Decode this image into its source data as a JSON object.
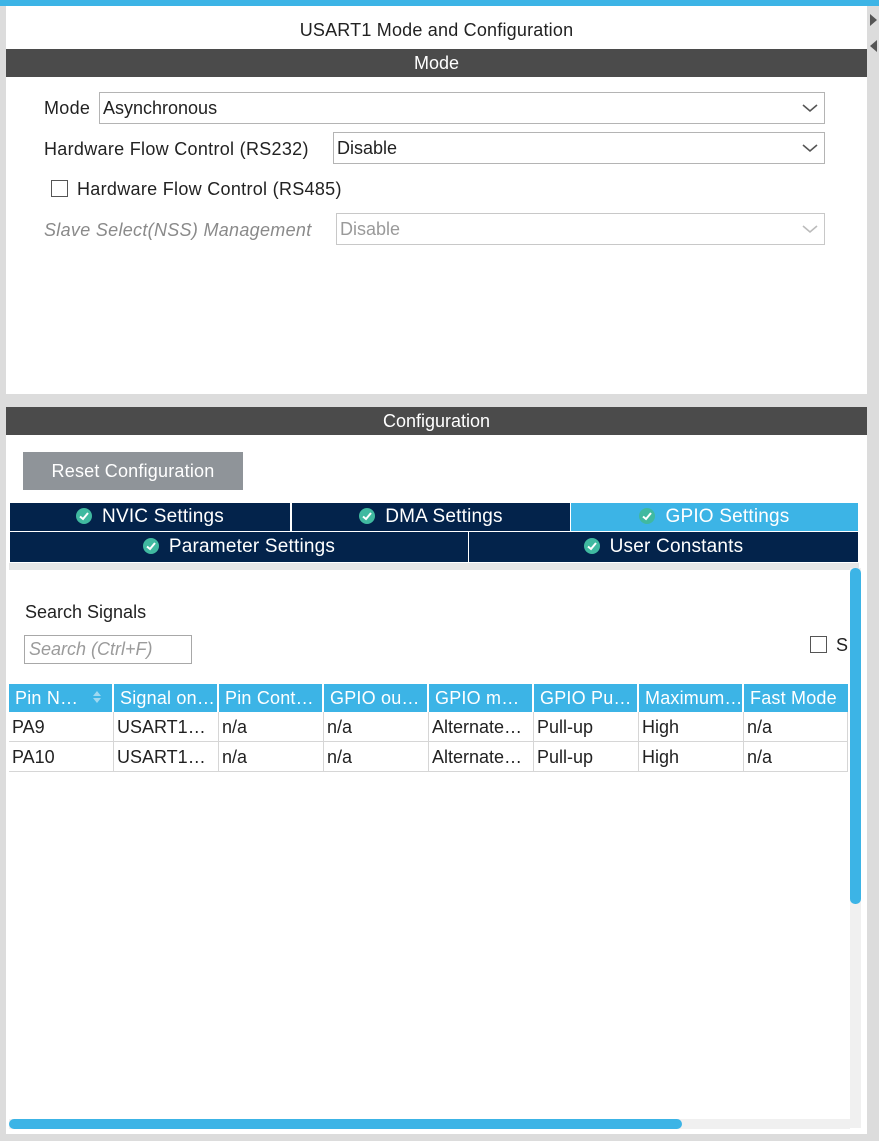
{
  "window": {
    "title": "USART1 Mode and Configuration"
  },
  "mode_section": {
    "header": "Mode",
    "mode_label": "Mode",
    "mode_value": "Asynchronous",
    "hw_flow_rs232_label": "Hardware Flow Control (RS232)",
    "hw_flow_rs232_value": "Disable",
    "hw_flow_rs485_label": "Hardware Flow Control (RS485)",
    "hw_flow_rs485_checked": false,
    "nss_label": "Slave Select(NSS) Management",
    "nss_value": "Disable"
  },
  "config_section": {
    "header": "Configuration",
    "reset_button": "Reset Configuration",
    "tabs": [
      {
        "label": "NVIC Settings",
        "active": false
      },
      {
        "label": "DMA Settings",
        "active": false
      },
      {
        "label": "GPIO Settings",
        "active": true
      },
      {
        "label": "Parameter Settings",
        "active": false
      },
      {
        "label": "User Constants",
        "active": false
      }
    ]
  },
  "gpio": {
    "search_label": "Search Signals",
    "search_placeholder": "Search (Ctrl+F)",
    "show_checkbox_label": "S",
    "columns": [
      "Pin N…",
      "Signal on…",
      "Pin Cont…",
      "GPIO ou…",
      "GPIO m…",
      "GPIO Pu…",
      "Maximum…",
      "Fast Mode"
    ],
    "rows": [
      [
        "PA9",
        "USART1…",
        "n/a",
        "n/a",
        "Alternate…",
        "Pull-up",
        "High",
        "n/a"
      ],
      [
        "PA10",
        "USART1…",
        "n/a",
        "n/a",
        "Alternate…",
        "Pull-up",
        "High",
        "n/a"
      ]
    ]
  },
  "colors": {
    "accent": "#3cb4e6",
    "tab_dark": "#03234b",
    "section_header": "#4b4b4b",
    "check_green": "#40b9a0",
    "button_gray": "#8f9499"
  },
  "icons": {
    "dropdown": "chevron-down-icon",
    "tab_status": "check-circle-icon",
    "sort": "sort-icon"
  }
}
